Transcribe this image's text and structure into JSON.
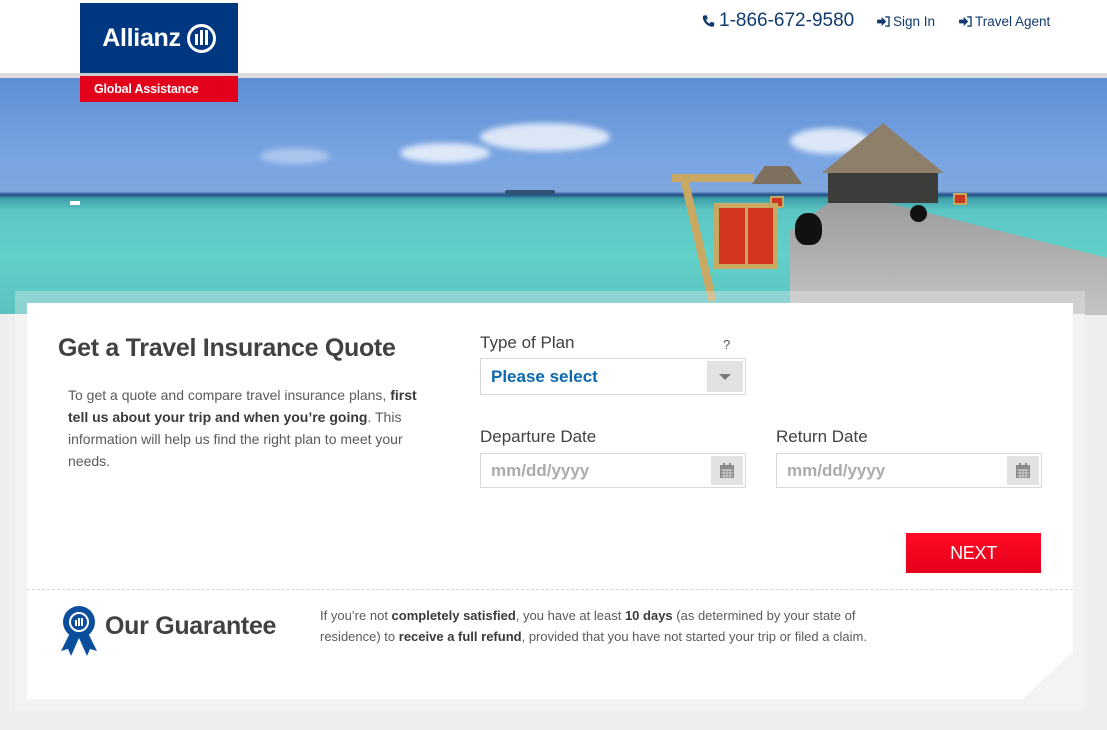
{
  "header": {
    "brand": "Allianz",
    "sub_brand": "Global Assistance",
    "phone": "1-866-672-9580",
    "sign_in": "Sign In",
    "travel_agent": "Travel Agent",
    "colors": {
      "brand_blue": "#003781",
      "brand_red": "#e2001a",
      "link": "#113b6f"
    }
  },
  "quote": {
    "title": "Get a Travel Insurance Quote",
    "intro": {
      "part1": "To get a quote and compare travel insurance plans, ",
      "bold": "first tell us about your trip and when you’re going",
      "part2": ". This information will help us find the right plan to meet your needs."
    },
    "plan": {
      "label": "Type of Plan",
      "help": "?",
      "selected": "Please select"
    },
    "departure": {
      "label": "Departure Date",
      "placeholder": "mm/dd/yyyy",
      "value": ""
    },
    "return": {
      "label": "Return Date",
      "placeholder": "mm/dd/yyyy",
      "value": ""
    },
    "next_label": "NEXT",
    "colors": {
      "next": "#f5001e",
      "select_value": "#0a6ab0"
    }
  },
  "guarantee": {
    "title": "Our Guarantee",
    "t1": "If you’re not ",
    "b1": "completely satisfied",
    "t2": ", you have at least ",
    "b2": "10 days",
    "t3": " (as determined by your state of residence) to ",
    "b3": "receive a full refund",
    "t4": ", provided that you have not started your trip or filed a claim."
  },
  "icons": {
    "phone": "phone-icon",
    "sign_in": "sign-in-icon",
    "dropdown": "caret-down-icon",
    "calendar": "calendar-icon",
    "guarantee": "award-ribbon-icon"
  }
}
